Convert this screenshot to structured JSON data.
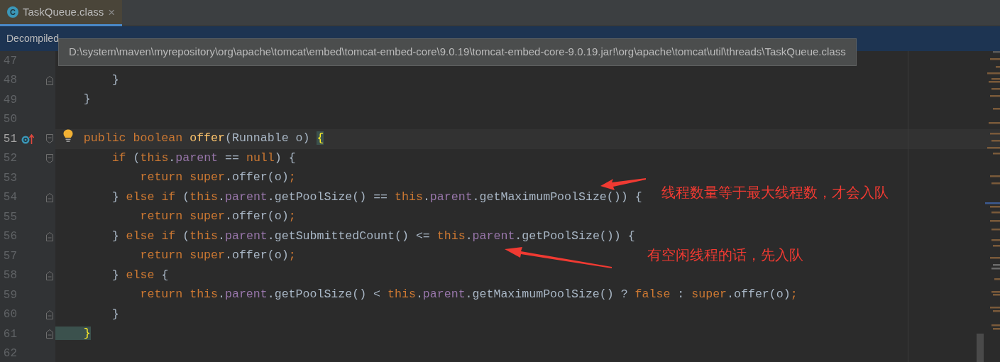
{
  "tabs": [
    {
      "icon_letter": "C",
      "label": "TaskQueue.class",
      "selected": true,
      "close": "×"
    }
  ],
  "banner": {
    "text": "Decompiled"
  },
  "tooltip": {
    "text": "D:\\system\\maven\\myrepository\\org\\apache\\tomcat\\embed\\tomcat-embed-core\\9.0.19\\tomcat-embed-core-9.0.19.jar!\\org\\apache\\tomcat\\util\\threads\\TaskQueue.class"
  },
  "editor": {
    "lines": [
      {
        "number": "47",
        "current": false,
        "fold_start": false,
        "fold_end": false,
        "override": false,
        "bulb": false
      },
      {
        "number": "48",
        "current": false,
        "fold_start": false,
        "fold_end": true,
        "override": false,
        "bulb": false,
        "tokens": [
          {
            "kind": "plain",
            "text": "        }"
          }
        ]
      },
      {
        "number": "49",
        "current": false,
        "fold_start": false,
        "fold_end": false,
        "override": false,
        "bulb": false,
        "tokens": [
          {
            "kind": "plain",
            "text": "    }"
          }
        ]
      },
      {
        "number": "50",
        "current": false,
        "fold_start": false,
        "fold_end": false,
        "override": false,
        "bulb": false
      },
      {
        "number": "51",
        "current": true,
        "fold_start": true,
        "fold_end": false,
        "override": true,
        "bulb": true,
        "tokens": [
          {
            "kind": "keyword",
            "text": "    public boolean "
          },
          {
            "kind": "declaration",
            "text": "offer"
          },
          {
            "kind": "plain",
            "text": "(Runnable o) "
          },
          {
            "kind": "matched",
            "text": "{"
          }
        ]
      },
      {
        "number": "52",
        "current": false,
        "fold_start": true,
        "fold_end": false,
        "override": false,
        "bulb": false,
        "tokens": [
          {
            "kind": "keyword",
            "text": "        if"
          },
          {
            "kind": "plain",
            "text": " ("
          },
          {
            "kind": "keyword",
            "text": "this"
          },
          {
            "kind": "plain",
            "text": "."
          },
          {
            "kind": "field",
            "text": "parent"
          },
          {
            "kind": "plain",
            "text": " == "
          },
          {
            "kind": "keyword",
            "text": "null"
          },
          {
            "kind": "plain",
            "text": ") {"
          }
        ]
      },
      {
        "number": "53",
        "current": false,
        "fold_start": false,
        "fold_end": false,
        "override": false,
        "bulb": false,
        "tokens": [
          {
            "kind": "keyword",
            "text": "            return super"
          },
          {
            "kind": "plain",
            "text": ".offer(o)"
          },
          {
            "kind": "keyword",
            "text": ";"
          }
        ]
      },
      {
        "number": "54",
        "current": false,
        "fold_start": false,
        "fold_end": true,
        "override": false,
        "bulb": false,
        "tokens": [
          {
            "kind": "plain",
            "text": "        } "
          },
          {
            "kind": "keyword",
            "text": "else if"
          },
          {
            "kind": "plain",
            "text": " ("
          },
          {
            "kind": "keyword",
            "text": "this"
          },
          {
            "kind": "plain",
            "text": "."
          },
          {
            "kind": "field",
            "text": "parent"
          },
          {
            "kind": "plain",
            "text": ".getPoolSize() == "
          },
          {
            "kind": "keyword",
            "text": "this"
          },
          {
            "kind": "plain",
            "text": "."
          },
          {
            "kind": "field",
            "text": "parent"
          },
          {
            "kind": "plain",
            "text": ".getMaximumPoolSize()) {"
          }
        ]
      },
      {
        "number": "55",
        "current": false,
        "fold_start": false,
        "fold_end": false,
        "override": false,
        "bulb": false,
        "tokens": [
          {
            "kind": "keyword",
            "text": "            return super"
          },
          {
            "kind": "plain",
            "text": ".offer(o)"
          },
          {
            "kind": "keyword",
            "text": ";"
          }
        ]
      },
      {
        "number": "56",
        "current": false,
        "fold_start": false,
        "fold_end": true,
        "override": false,
        "bulb": false,
        "tokens": [
          {
            "kind": "plain",
            "text": "        } "
          },
          {
            "kind": "keyword",
            "text": "else if"
          },
          {
            "kind": "plain",
            "text": " ("
          },
          {
            "kind": "keyword",
            "text": "this"
          },
          {
            "kind": "plain",
            "text": "."
          },
          {
            "kind": "field",
            "text": "parent"
          },
          {
            "kind": "plain",
            "text": ".getSubmittedCount() <= "
          },
          {
            "kind": "keyword",
            "text": "this"
          },
          {
            "kind": "plain",
            "text": "."
          },
          {
            "kind": "field",
            "text": "parent"
          },
          {
            "kind": "plain",
            "text": ".getPoolSize()) {"
          }
        ]
      },
      {
        "number": "57",
        "current": false,
        "fold_start": false,
        "fold_end": false,
        "override": false,
        "bulb": false,
        "tokens": [
          {
            "kind": "keyword",
            "text": "            return super"
          },
          {
            "kind": "plain",
            "text": ".offer(o)"
          },
          {
            "kind": "keyword",
            "text": ";"
          }
        ]
      },
      {
        "number": "58",
        "current": false,
        "fold_start": false,
        "fold_end": true,
        "override": false,
        "bulb": false,
        "tokens": [
          {
            "kind": "plain",
            "text": "        } "
          },
          {
            "kind": "keyword",
            "text": "else"
          },
          {
            "kind": "plain",
            "text": " {"
          }
        ]
      },
      {
        "number": "59",
        "current": false,
        "fold_start": false,
        "fold_end": false,
        "override": false,
        "bulb": false,
        "tokens": [
          {
            "kind": "keyword",
            "text": "            return this"
          },
          {
            "kind": "plain",
            "text": "."
          },
          {
            "kind": "field",
            "text": "parent"
          },
          {
            "kind": "plain",
            "text": ".getPoolSize() < "
          },
          {
            "kind": "keyword",
            "text": "this"
          },
          {
            "kind": "plain",
            "text": "."
          },
          {
            "kind": "field",
            "text": "parent"
          },
          {
            "kind": "plain",
            "text": ".getMaximumPoolSize() ? "
          },
          {
            "kind": "keyword",
            "text": "false"
          },
          {
            "kind": "plain",
            "text": " : "
          },
          {
            "kind": "keyword",
            "text": "super"
          },
          {
            "kind": "plain",
            "text": ".offer(o)"
          },
          {
            "kind": "keyword",
            "text": ";"
          }
        ]
      },
      {
        "number": "60",
        "current": false,
        "fold_start": false,
        "fold_end": true,
        "override": false,
        "bulb": false,
        "tokens": [
          {
            "kind": "plain",
            "text": "        }"
          }
        ]
      },
      {
        "number": "61",
        "current": false,
        "fold_start": false,
        "fold_end": true,
        "override": false,
        "bulb": false,
        "tokens": [
          {
            "kind": "matched",
            "text": "    }"
          }
        ]
      },
      {
        "number": "62",
        "current": false,
        "fold_start": false,
        "fold_end": false,
        "override": false,
        "bulb": false
      }
    ]
  },
  "annotations": [
    {
      "text": "线程数量等于最大线程数，才会入队"
    },
    {
      "text": "有空闲线程的话，先入队"
    }
  ]
}
